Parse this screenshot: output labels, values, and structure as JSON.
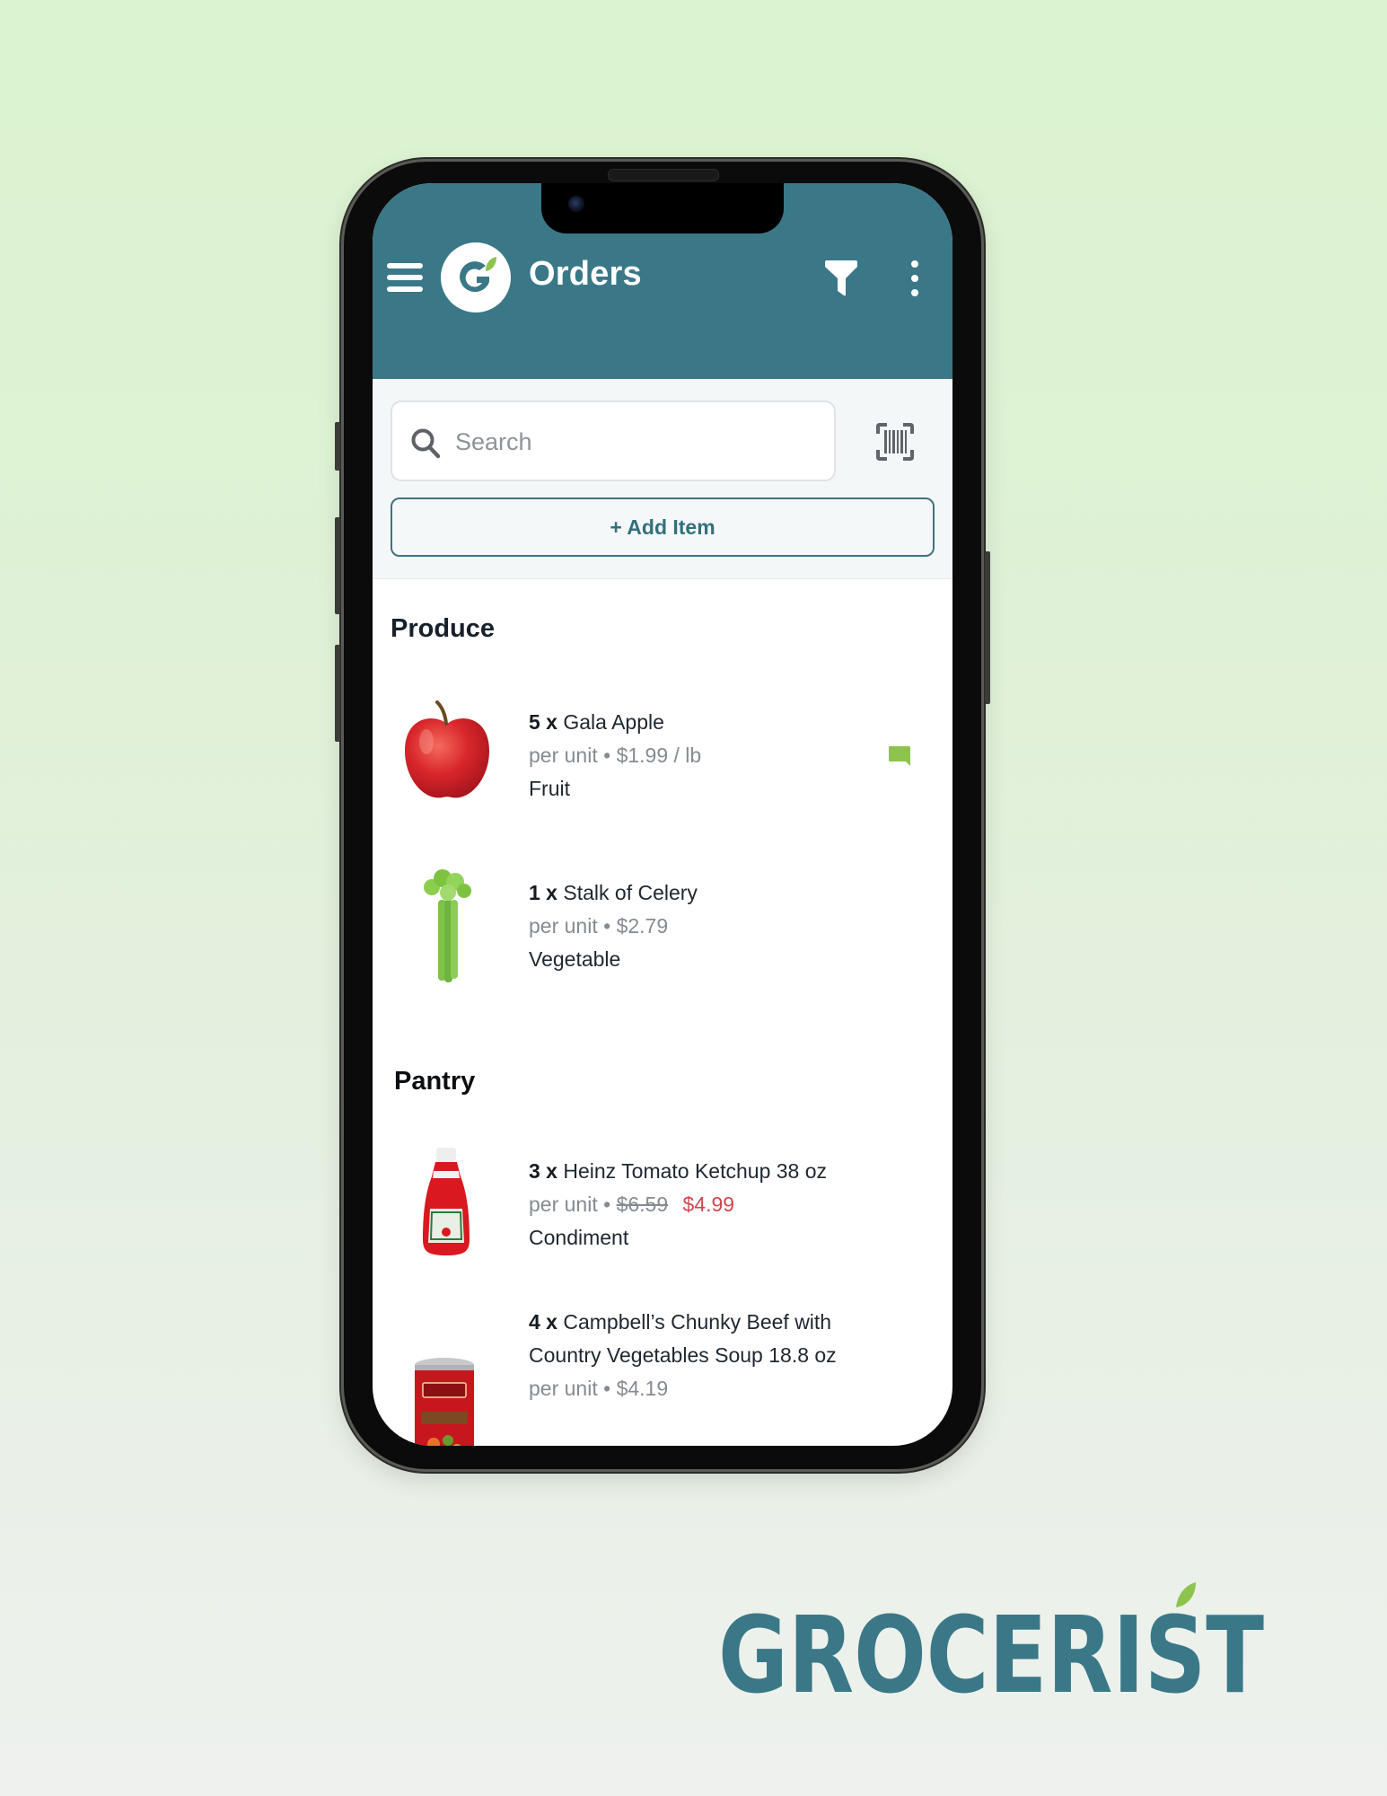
{
  "app": {
    "title": "Orders",
    "icons": {
      "menu": "hamburger-icon",
      "logo": "grocerist-g-logo",
      "filter": "funnel-icon",
      "more": "vertical-dots-icon",
      "search": "magnifier-icon",
      "barcode": "barcode-scan-icon",
      "comment": "comment-bubble-icon"
    }
  },
  "search": {
    "placeholder": "Search",
    "value": ""
  },
  "actions": {
    "add_item_label": "+ Add Item"
  },
  "sections": [
    {
      "title": "Produce",
      "items": [
        {
          "quantity": "5 x",
          "name": "Gala Apple",
          "price_prefix": "per unit •",
          "price": "$1.99 / lb",
          "category": "Fruit",
          "has_comment": true,
          "image": "red apple"
        },
        {
          "quantity": "1 x",
          "name": "Stalk of Celery",
          "price_prefix": "per unit •",
          "price": "$2.79",
          "category": "Vegetable",
          "has_comment": false,
          "image": "celery stalk"
        }
      ]
    },
    {
      "title": "Pantry",
      "items": [
        {
          "quantity": "3 x",
          "name": "Heinz Tomato Ketchup 38 oz",
          "price_prefix": "per unit •",
          "original_price": "$6.59",
          "price": "$4.99",
          "category": "Condiment",
          "has_comment": false,
          "image": "ketchup bottle"
        },
        {
          "quantity": "4 x",
          "name": "Campbell’s Chunky Beef with Country Vegetables Soup 18.8 oz",
          "price_prefix": "per unit •",
          "price": "$4.19",
          "category": "",
          "has_comment": false,
          "image": "soup can"
        }
      ]
    }
  ],
  "brand": {
    "wordmark": "GROCERIST"
  },
  "colors": {
    "primary": "#3a7887",
    "accent_green": "#8dc44e",
    "sale_red": "#d0464d",
    "muted_text": "#858b92"
  }
}
